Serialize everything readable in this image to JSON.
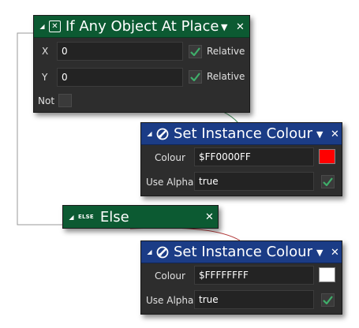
{
  "colors": {
    "canvas": "#ffffff",
    "panel": "#2d2d2d",
    "header_green": "#0c5a32",
    "header_blue": "#1b3c86",
    "check_green": "#3fae6a",
    "red": "#ff0000",
    "white": "#ffffff"
  },
  "if_object": {
    "title": "If Any Object At Place",
    "icon": "object-at-place-icon",
    "fields": {
      "x_label": "X",
      "x_value": "0",
      "x_relative_label": "Relative",
      "x_relative_checked": true,
      "y_label": "Y",
      "y_value": "0",
      "y_relative_label": "Relative",
      "y_relative_checked": true,
      "not_label": "Not",
      "not_checked": false
    }
  },
  "set_colour_1": {
    "title": "Set Instance Colour",
    "icon": "paint-brush-icon",
    "colour_label": "Colour",
    "colour_value": "$FF0000FF",
    "colour_swatch": "#ff0000",
    "alpha_label": "Use Alpha",
    "alpha_value": "true",
    "alpha_checked": true
  },
  "else_node": {
    "icon_text": "ELSE",
    "title": "Else"
  },
  "set_colour_2": {
    "title": "Set Instance Colour",
    "icon": "paint-brush-icon",
    "colour_label": "Colour",
    "colour_value": "$FFFFFFFF",
    "colour_swatch": "#ffffff",
    "alpha_label": "Use Alpha",
    "alpha_value": "true",
    "alpha_checked": true
  }
}
